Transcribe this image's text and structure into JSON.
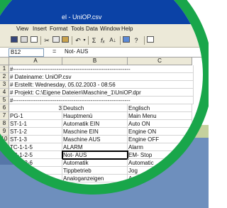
{
  "window": {
    "title": "el - UniOP.csv"
  },
  "menu": [
    "View",
    "Insert",
    "Format",
    "Tools",
    "Data",
    "Window",
    "Help"
  ],
  "toolbar": {
    "sigma": "Σ",
    "fx": "fₓ",
    "sort": "A↓",
    "undo": "↶"
  },
  "formula_bar": {
    "cell_ref": "B12",
    "equals": "=",
    "value": "Not- AUS"
  },
  "columns": [
    "A",
    "B",
    "C"
  ],
  "rows": [
    {
      "n": "1",
      "a": "#--------------------------------------------------------------",
      "b": "",
      "c": ""
    },
    {
      "n": "2",
      "a": "# Dateiname: UniOP.csv",
      "b": "",
      "c": ""
    },
    {
      "n": "3",
      "a": "# Erstellt:  Wednesday, 05.02.2003 - 08:56",
      "b": "",
      "c": ""
    },
    {
      "n": "4",
      "a": "# Projekt:  C:\\Eigene Dateien\\Maschine_1\\UniOP.dpr",
      "b": "",
      "c": ""
    },
    {
      "n": "5",
      "a": "#--------------------------------------------------------------",
      "b": "",
      "c": ""
    },
    {
      "n": "6",
      "a": "3",
      "b": "Deutsch",
      "c": "Englisch"
    },
    {
      "n": "7",
      "a": "PG-1",
      "b": "Hauptmenü",
      "c": "Main Menu"
    },
    {
      "n": "8",
      "a": "ST-1-1",
      "b": "Automatik EIN",
      "c": "Auto ON"
    },
    {
      "n": "9",
      "a": "ST-1-2",
      "b": "Maschine EIN",
      "c": "Engine ON"
    },
    {
      "n": "10",
      "a": "ST-1-3",
      "b": "Maschine AUS",
      "c": "Engine OFF"
    },
    {
      "n": "11",
      "a": "TC-1-1-5",
      "b": "ALARM",
      "c": "Alarm"
    },
    {
      "n": "12",
      "a": "TC-1-2-5",
      "b": "Not- AUS",
      "c": "EM- Stop"
    },
    {
      "n": "13",
      "a": "TC-1-3-6",
      "b": "Automatik",
      "c": "Automatic"
    },
    {
      "n": "14",
      "a": "TC-1-4-6",
      "b": "Tippbetrieb",
      "c": "Jog"
    },
    {
      "n": "15",
      "a": "",
      "b": "Analoganzeigen",
      "c": "Analogue G"
    }
  ]
}
